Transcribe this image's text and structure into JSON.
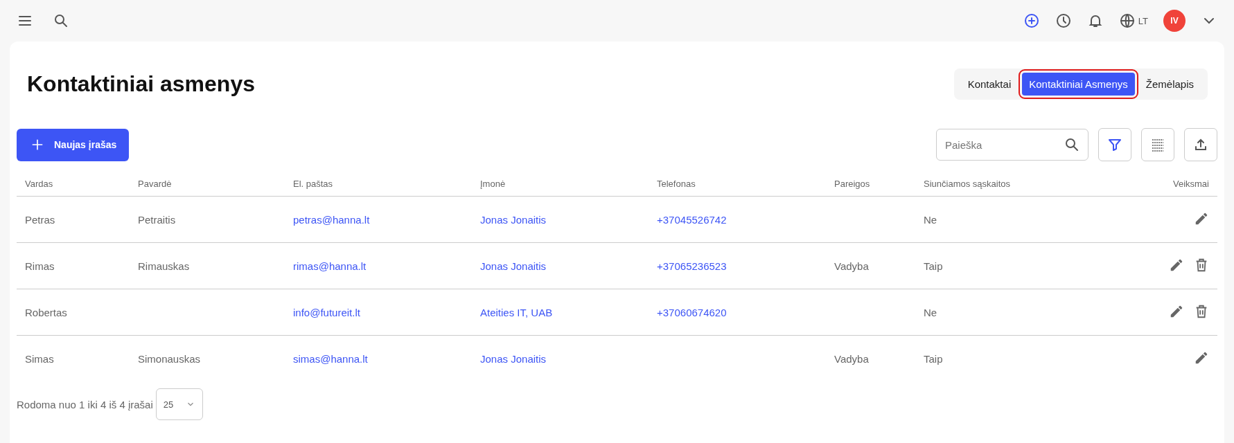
{
  "top_bar": {
    "language": "LT",
    "avatar_initials": "IV"
  },
  "page": {
    "title": "Kontaktiniai asmenys"
  },
  "tabs": [
    {
      "label": "Kontaktai",
      "selected": false
    },
    {
      "label": "Kontaktiniai Asmenys",
      "selected": true
    },
    {
      "label": "Žemėlapis",
      "selected": false
    }
  ],
  "new_button": {
    "label": "Naujas įrašas"
  },
  "search": {
    "placeholder": "Paieška"
  },
  "table": {
    "columns": [
      "Vardas",
      "Pavardė",
      "El. paštas",
      "Įmonė",
      "Telefonas",
      "Pareigos",
      "Siunčiamos sąskaitos",
      "Veiksmai"
    ],
    "rows": [
      {
        "first_name": "Petras",
        "last_name": "Petraitis",
        "email": "petras@hanna.lt",
        "company": "Jonas Jonaitis",
        "phone": "+37045526742",
        "invoices": "Ne",
        "can_edit": true,
        "can_delete": false
      },
      {
        "first_name": "Rimas",
        "last_name": "Rimauskas",
        "email": "rimas@hanna.lt",
        "company": "Jonas Jonaitis",
        "phone": "+37065236523",
        "position": "Vadyba",
        "invoices": "Taip",
        "can_edit": true,
        "can_delete": true
      },
      {
        "first_name": "Robertas",
        "email": "info@futureit.lt",
        "company": "Ateities IT, UAB",
        "phone": "+37060674620",
        "invoices": "Ne",
        "can_edit": true,
        "can_delete": true
      },
      {
        "first_name": "Simas",
        "last_name": "Simonauskas",
        "email": "simas@hanna.lt",
        "company": "Jonas Jonaitis",
        "position": "Vadyba",
        "invoices": "Taip",
        "can_edit": true,
        "can_delete": false
      }
    ]
  },
  "pagination": {
    "summary": "Rodoma nuo 1 iki 4 iš 4 įrašai",
    "page_size": "25"
  }
}
